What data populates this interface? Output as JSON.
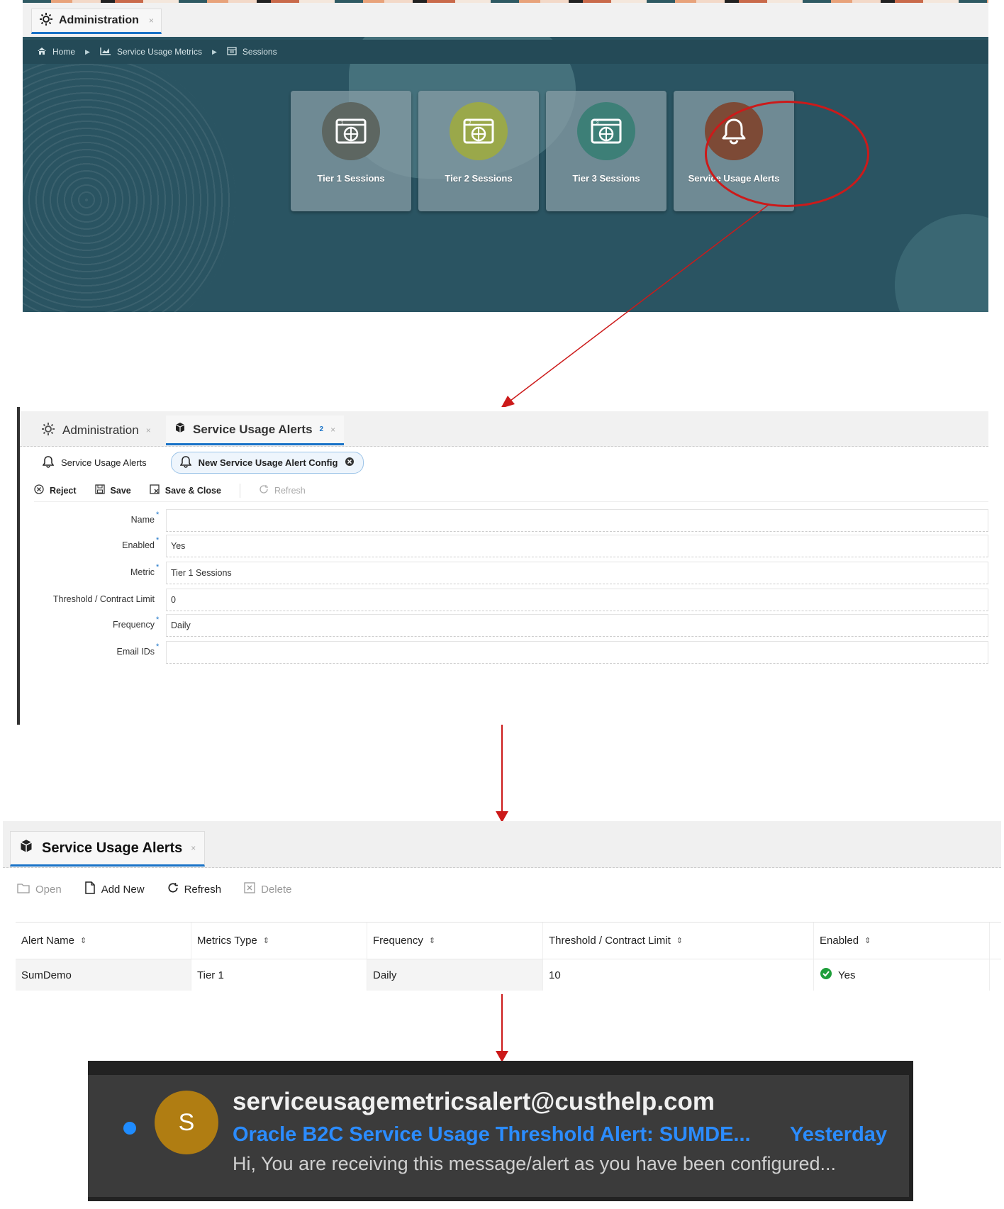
{
  "panel1": {
    "tab": {
      "label": "Administration",
      "close": "×"
    },
    "breadcrumb": [
      "Home",
      "Service Usage Metrics",
      "Sessions"
    ],
    "tiles": [
      {
        "label": "Tier 1 Sessions",
        "color": "#5d6661",
        "icon": "tier-1-globe-icon"
      },
      {
        "label": "Tier 2 Sessions",
        "color": "#9aa84a",
        "icon": "tier-2-globe-icon"
      },
      {
        "label": "Tier 3 Sessions",
        "color": "#3d7f77",
        "icon": "tier-3-globe-icon"
      },
      {
        "label": "Service Usage Alerts",
        "color": "#7d4a36",
        "icon": "bell-icon"
      }
    ],
    "highlight_color": "#cc1a1a"
  },
  "panel2": {
    "tabs": [
      {
        "label": "Administration",
        "close": "×"
      },
      {
        "label": "Service Usage Alerts",
        "badge": "2",
        "close": "×"
      }
    ],
    "subtabs": [
      {
        "label": "Service Usage Alerts"
      },
      {
        "label": "New Service Usage Alert Config"
      }
    ],
    "toolbar": {
      "reject": "Reject",
      "save": "Save",
      "save_close": "Save & Close",
      "refresh": "Refresh"
    },
    "form": [
      {
        "label": "Name",
        "required": true,
        "value": ""
      },
      {
        "label": "Enabled",
        "required": true,
        "value": "Yes"
      },
      {
        "label": "Metric",
        "required": true,
        "value": "Tier 1 Sessions"
      },
      {
        "label": "Threshold / Contract Limit",
        "required": false,
        "value": "0"
      },
      {
        "label": "Frequency",
        "required": true,
        "value": "Daily"
      },
      {
        "label": "Email IDs",
        "required": true,
        "value": ""
      }
    ],
    "required_mark": "*"
  },
  "panel3": {
    "tab": {
      "label": "Service Usage Alerts",
      "close": "×"
    },
    "toolbar": {
      "open": "Open",
      "add_new": "Add New",
      "refresh": "Refresh",
      "delete": "Delete"
    },
    "columns": [
      "Alert Name",
      "Metrics Type",
      "Frequency",
      "Threshold / Contract Limit",
      "Enabled"
    ],
    "rows": [
      {
        "alert_name": "SumDemo",
        "metrics_type": "Tier 1",
        "frequency": "Daily",
        "threshold": "10",
        "enabled": "Yes"
      }
    ],
    "enabled_color": "#1e9e3a"
  },
  "panel4": {
    "avatar_letter": "S",
    "sender": "serviceusagemetricsalert@custhelp.com",
    "subject": "Oracle B2C Service Usage Threshold Alert: SUMDE...",
    "when": "Yesterday",
    "preview": "Hi, You are receiving this message/alert as you have been configured..."
  }
}
